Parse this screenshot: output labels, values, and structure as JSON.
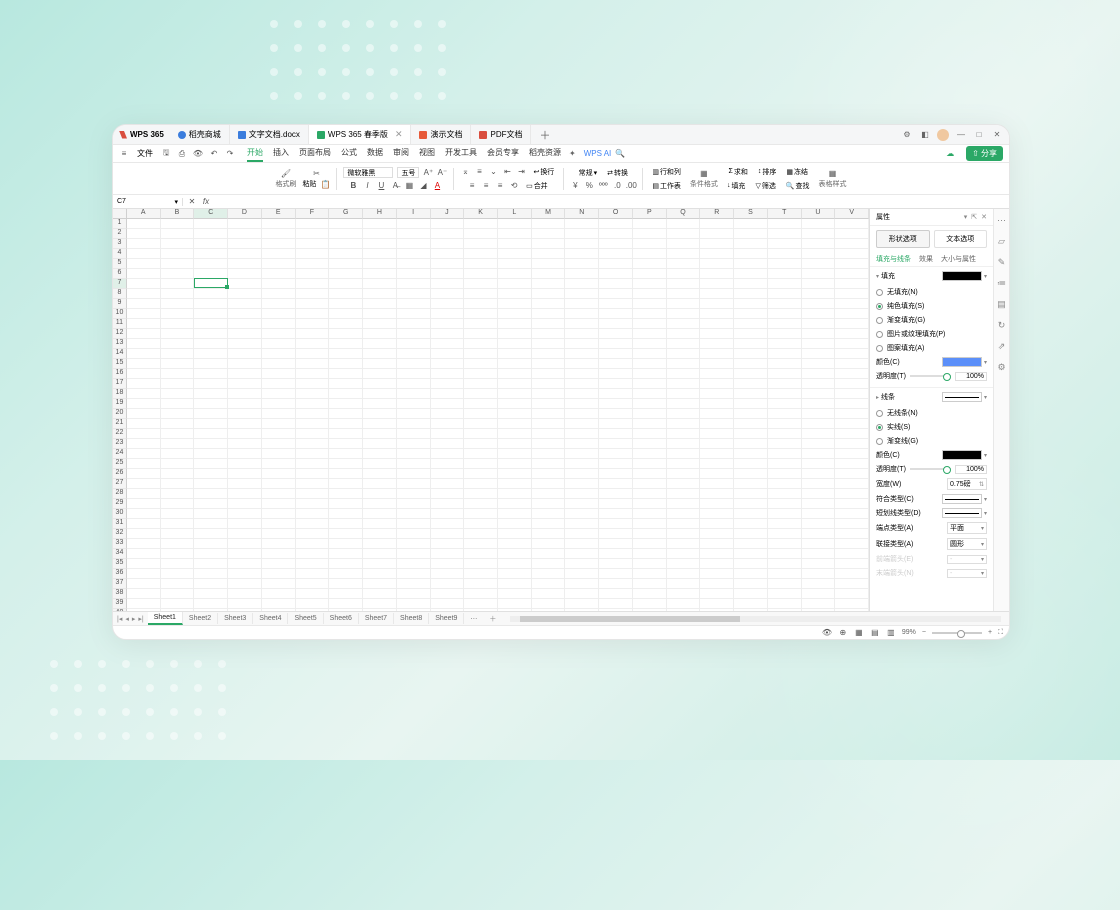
{
  "brand": "WPS 365",
  "tabs": [
    {
      "icon": "dao",
      "label": "稻壳商城"
    },
    {
      "icon": "doc",
      "label": "文字文档.docx"
    },
    {
      "icon": "xls",
      "label": "WPS 365 春季版",
      "active": true,
      "closeable": true
    },
    {
      "icon": "ppt",
      "label": "演示文档"
    },
    {
      "icon": "pdf",
      "label": "PDF文档"
    }
  ],
  "menu": {
    "file": "文件",
    "tabs": [
      "开始",
      "插入",
      "页面布局",
      "公式",
      "数据",
      "审阅",
      "视图",
      "开发工具",
      "会员专享",
      "稻壳资源"
    ],
    "active": 0,
    "ai": "WPS AI"
  },
  "share": {
    "cloud": "☁",
    "label": "分享"
  },
  "ribbon": {
    "fmtbrush": "格式刷",
    "paste": "粘贴",
    "font": "微软雅黑",
    "size": "五号",
    "wrap": "换行",
    "general": "常规",
    "convert": "转换",
    "rowsCols": "行和列",
    "worksheet": "工作表",
    "condFmt": "条件格式",
    "sum": "求和",
    "fill": "填充",
    "sort": "排序",
    "filter": "筛选",
    "freeze": "冻结",
    "find": "查找",
    "tableStyle": "表格样式",
    "merge": "合并"
  },
  "cellRef": "C7",
  "columns": [
    "A",
    "B",
    "C",
    "D",
    "E",
    "F",
    "G",
    "H",
    "I",
    "J",
    "K",
    "L",
    "M",
    "N",
    "O",
    "P",
    "Q",
    "R",
    "S",
    "T",
    "U",
    "V"
  ],
  "selection": {
    "col": 2,
    "row": 6
  },
  "rowCount": 45,
  "properties": {
    "title": "属性",
    "mainTabs": [
      "形状选项",
      "文本选项"
    ],
    "subTabs": [
      "填充与线条",
      "效果",
      "大小与属性"
    ],
    "fill": {
      "title": "填充",
      "opts": [
        "无填充(N)",
        "纯色填充(S)",
        "渐变填充(G)",
        "图片或纹理填充(P)",
        "图案填充(A)"
      ],
      "selected": 1,
      "color": "颜色(C)",
      "opacity": "透明度(T)",
      "opacityVal": "100%"
    },
    "line": {
      "title": "线条",
      "opts": [
        "无线条(N)",
        "实线(S)",
        "渐变线(G)"
      ],
      "selected": 1,
      "color": "颜色(C)",
      "opacity": "透明度(T)",
      "opacityVal": "100%",
      "width": "宽度(W)",
      "widthVal": "0.75磅",
      "compound": "符合类型(C)",
      "dash": "短划线类型(D)",
      "cap": "端点类型(A)",
      "capVal": "平面",
      "join": "联接类型(A)",
      "joinVal": "圆形",
      "arrowStart": "前端箭头(E)",
      "arrowEnd": "末端箭头(N)"
    }
  },
  "sheets": [
    "Sheet1",
    "Sheet2",
    "Sheet3",
    "Sheet4",
    "Sheet5",
    "Sheet6",
    "Sheet7",
    "Sheet8",
    "Sheet9"
  ],
  "zoom": "99%"
}
